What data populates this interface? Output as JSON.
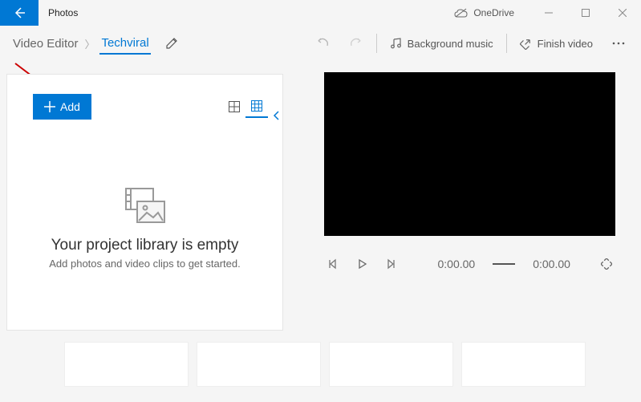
{
  "titlebar": {
    "app_name": "Photos",
    "onedrive_label": "OneDrive"
  },
  "toolbar": {
    "breadcrumb_root": "Video Editor",
    "breadcrumb_current": "Techviral",
    "bg_music_label": "Background music",
    "finish_label": "Finish video"
  },
  "library": {
    "add_label": "Add",
    "empty_title": "Your project library is empty",
    "empty_sub": "Add photos and video clips to get started."
  },
  "player": {
    "time_current": "0:00.00",
    "time_total": "0:00.00"
  }
}
